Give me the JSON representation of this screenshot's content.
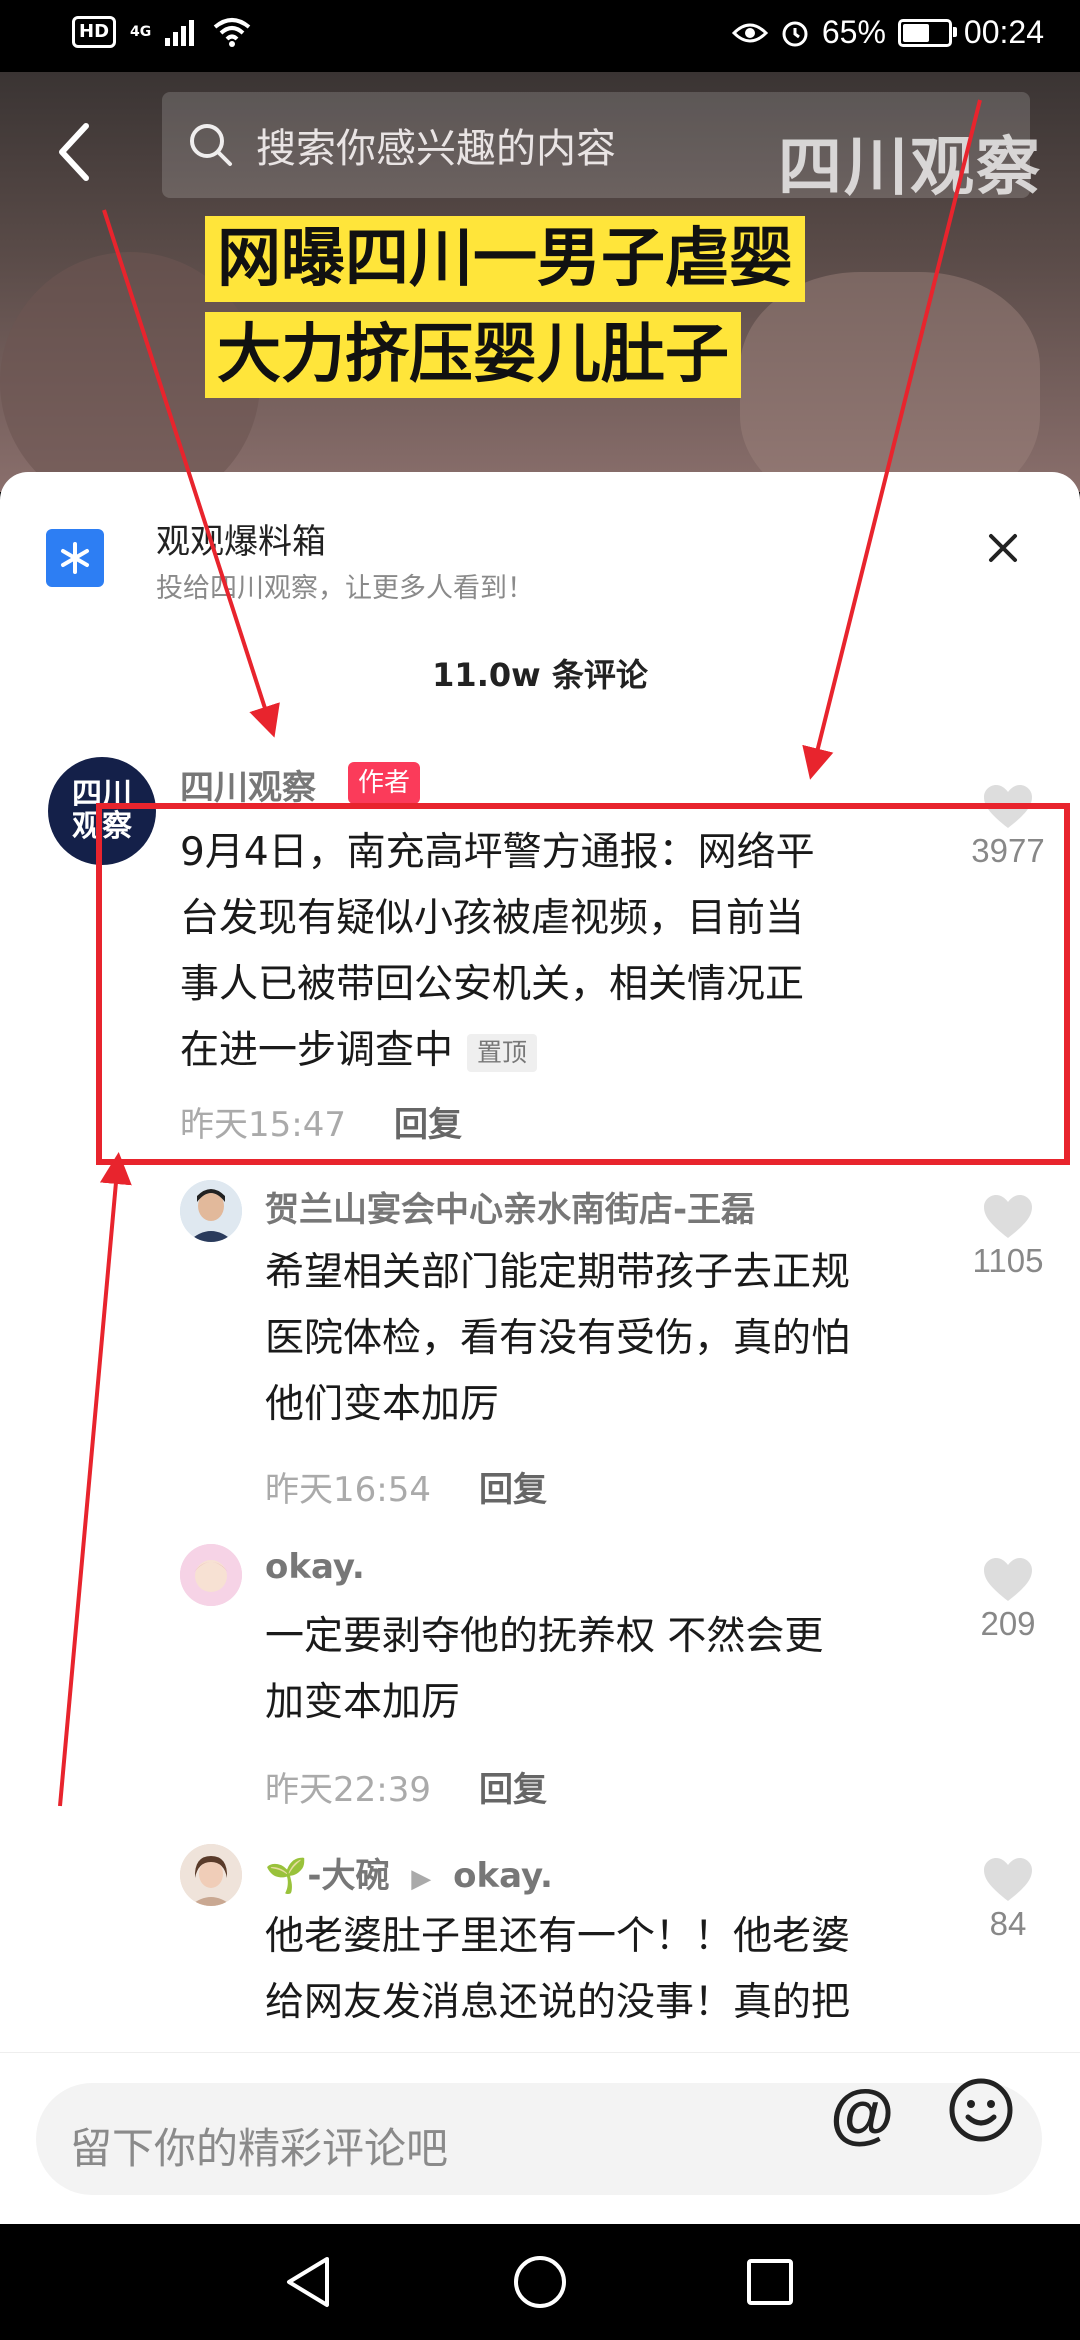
{
  "status_bar": {
    "hd": "HD",
    "signal": "4G",
    "battery": "65%",
    "battery_level": 0.65,
    "time": "00:24"
  },
  "search": {
    "placeholder": "搜索你感兴趣的内容"
  },
  "video": {
    "watermark": "四川观察",
    "headline_1": "网曝四川一男子虐婴",
    "headline_2": "大力挤压婴儿肚子"
  },
  "promo": {
    "title": "观观爆料箱",
    "subtitle": "投给四川观察，让更多人看到！"
  },
  "comments_count": "11.0w 条评论",
  "author_tag": "作者",
  "pin_tag": "置顶",
  "reply_label": "回复",
  "comments": [
    {
      "avatar_text": "四川观察",
      "user": "四川观察",
      "lines": [
        "9月4日，南充高坪警方通报：网络平",
        "台发现有疑似小孩被虐视频，目前当",
        "事人已被带回公安机关，相关情况正",
        "在进一步调查中"
      ],
      "time": "昨天15:47",
      "likes": "3977"
    },
    {
      "user": "贺兰山宴会中心亲水南街店-王磊",
      "lines": [
        "希望相关部门能定期带孩子去正规",
        "医院体检，看有没有受伤，真的怕",
        "他们变本加厉"
      ],
      "time": "昨天16:54",
      "likes": "1105"
    },
    {
      "user": "okay.",
      "lines": [
        "一定要剥夺他的抚养权 不然会更",
        "加变本加厉"
      ],
      "time": "昨天22:39",
      "likes": "209"
    },
    {
      "user": "🌱-大碗",
      "reply_to": "okay.",
      "lines": [
        "他老婆肚子里还有一个！！他老婆",
        "给网友发消息还说的没事！真的把"
      ],
      "likes": "84"
    }
  ],
  "input": {
    "placeholder": "留下你的精彩评论吧",
    "at": "@"
  },
  "icons": {
    "search": "search-icon",
    "back": "back-arrow-icon",
    "close": "close-icon",
    "heart": "heart-icon",
    "emoji": "emoji-icon",
    "nav_back": "nav-back-icon",
    "nav_home": "nav-home-icon",
    "nav_recent": "nav-recent-icon"
  },
  "colors": {
    "author_tag": "#fb3b5a",
    "highlight": "#e8242d",
    "headline_bg": "#ffe53a",
    "promo_icon": "#2d7ef3"
  }
}
